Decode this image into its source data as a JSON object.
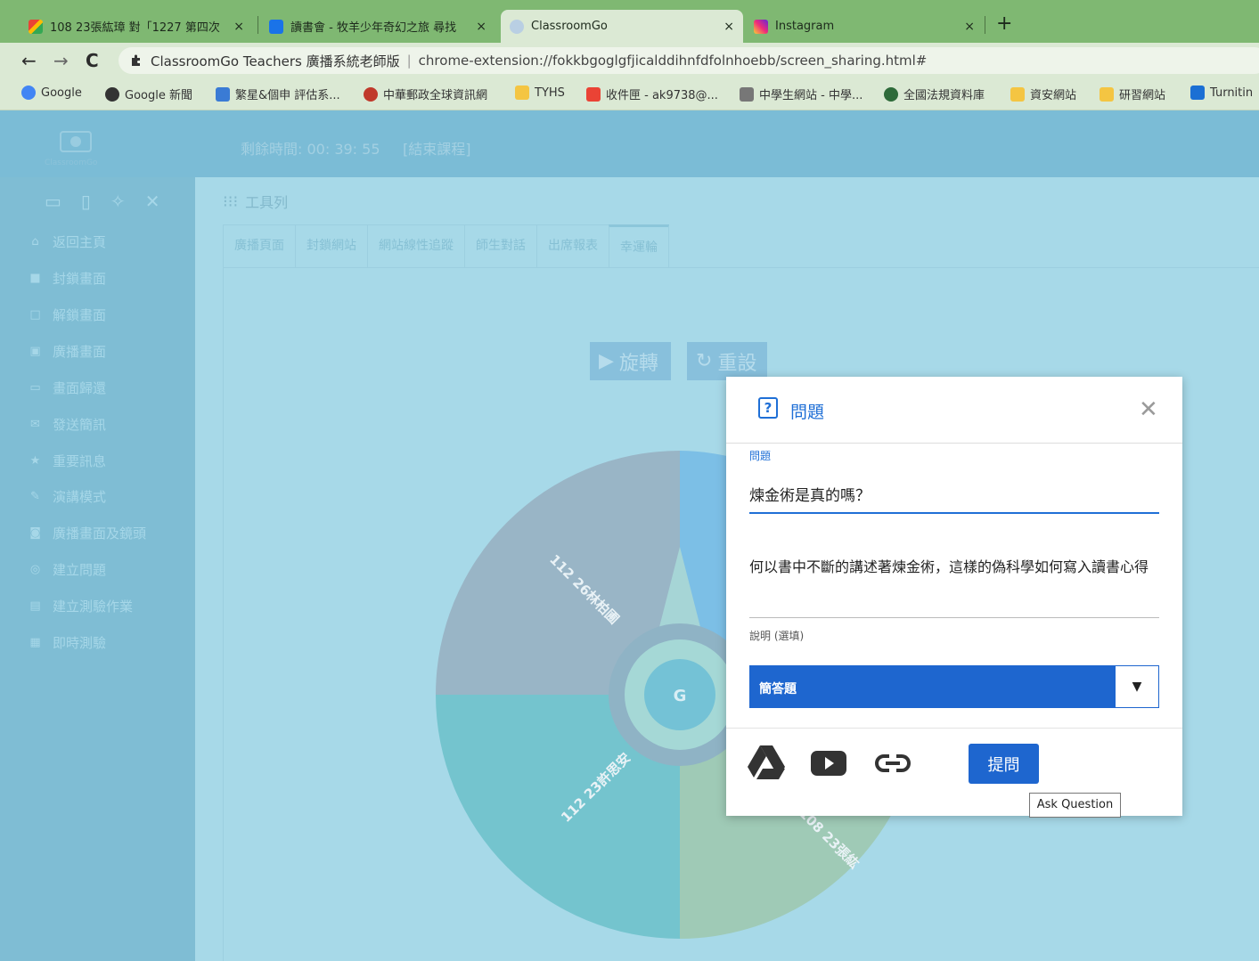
{
  "browser": {
    "tabs": [
      {
        "title": "108 23張紘璋 對「1227 第四次",
        "icon": "gmail-icon"
      },
      {
        "title": "讀書會 - 牧羊少年奇幻之旅 尋找",
        "icon": "classroom-icon"
      },
      {
        "title": "ClassroomGo",
        "icon": "classroomgo-icon"
      },
      {
        "title": "Instagram",
        "icon": "instagram-icon"
      }
    ],
    "close_glyph": "×",
    "newtab": "+",
    "nav": {
      "back": "←",
      "forward": "→",
      "reload": "C"
    },
    "omnibox": {
      "site": "ClassroomGo Teachers 廣播系統老師版",
      "separator": "|",
      "url": "chrome-extension://fokkbgoglgfjicalddihnfdfolnhoebb/screen_sharing.html#"
    },
    "bookmarks": [
      "Google",
      "Google 新聞",
      "繁星&個申 評估系...",
      "中華郵政全球資訊網",
      "TYHS",
      "收件匣 - ak9738@...",
      "中學生網站 - 中學...",
      "全國法規資料庫",
      "資安網站",
      "研習網站",
      "Turnitin"
    ]
  },
  "app": {
    "logo_text": "ClassroomGo",
    "timer": "剩餘時間: 00: 39: 55",
    "end_class": "[結束課程]",
    "sidebar": [
      {
        "label": "返回主頁",
        "icon": "home-icon"
      },
      {
        "label": "封鎖畫面",
        "icon": "lock-icon"
      },
      {
        "label": "解鎖畫面",
        "icon": "unlock-icon"
      },
      {
        "label": "廣播畫面",
        "icon": "broadcast-icon"
      },
      {
        "label": "畫面歸還",
        "icon": "screen-return-icon"
      },
      {
        "label": "發送簡訊",
        "icon": "message-icon"
      },
      {
        "label": "重要訊息",
        "icon": "star-icon"
      },
      {
        "label": "演講模式",
        "icon": "pen-icon"
      },
      {
        "label": "廣播畫面及鏡頭",
        "icon": "camera-icon"
      },
      {
        "label": "建立問題",
        "icon": "question-icon"
      },
      {
        "label": "建立測驗作業",
        "icon": "quiz-icon"
      },
      {
        "label": "即時測驗",
        "icon": "live-quiz-icon"
      }
    ],
    "toolbar_label": "工具列",
    "tabs": [
      "廣播頁面",
      "封鎖網站",
      "網站線性追蹤",
      "師生對話",
      "出席報表",
      "幸運輪"
    ],
    "spin_label": "旋轉",
    "reset_label": "重設",
    "wheel_labels": [
      "112 26林柏圃",
      "112 23許思安",
      "108 23張紘"
    ]
  },
  "dialog": {
    "title": "問題",
    "question_label": "問題",
    "question_value": "煉金術是真的嗎？",
    "description": "何以書中不斷的講述著煉金術，這樣的偽科學如何寫入讀書心得",
    "description_label": "說明 (選填)",
    "question_type": "簡答題",
    "ask_button": "提問",
    "tooltip": "Ask Question",
    "icons": [
      "drive-icon",
      "youtube-icon",
      "link-icon"
    ]
  },
  "colors": {
    "primary": "#1e66cf",
    "app_bg": "#a7d9e8",
    "header": "#7bbcd6",
    "sidebar": "#7fbdd4",
    "chrome_tabbar": "#7fb872"
  }
}
